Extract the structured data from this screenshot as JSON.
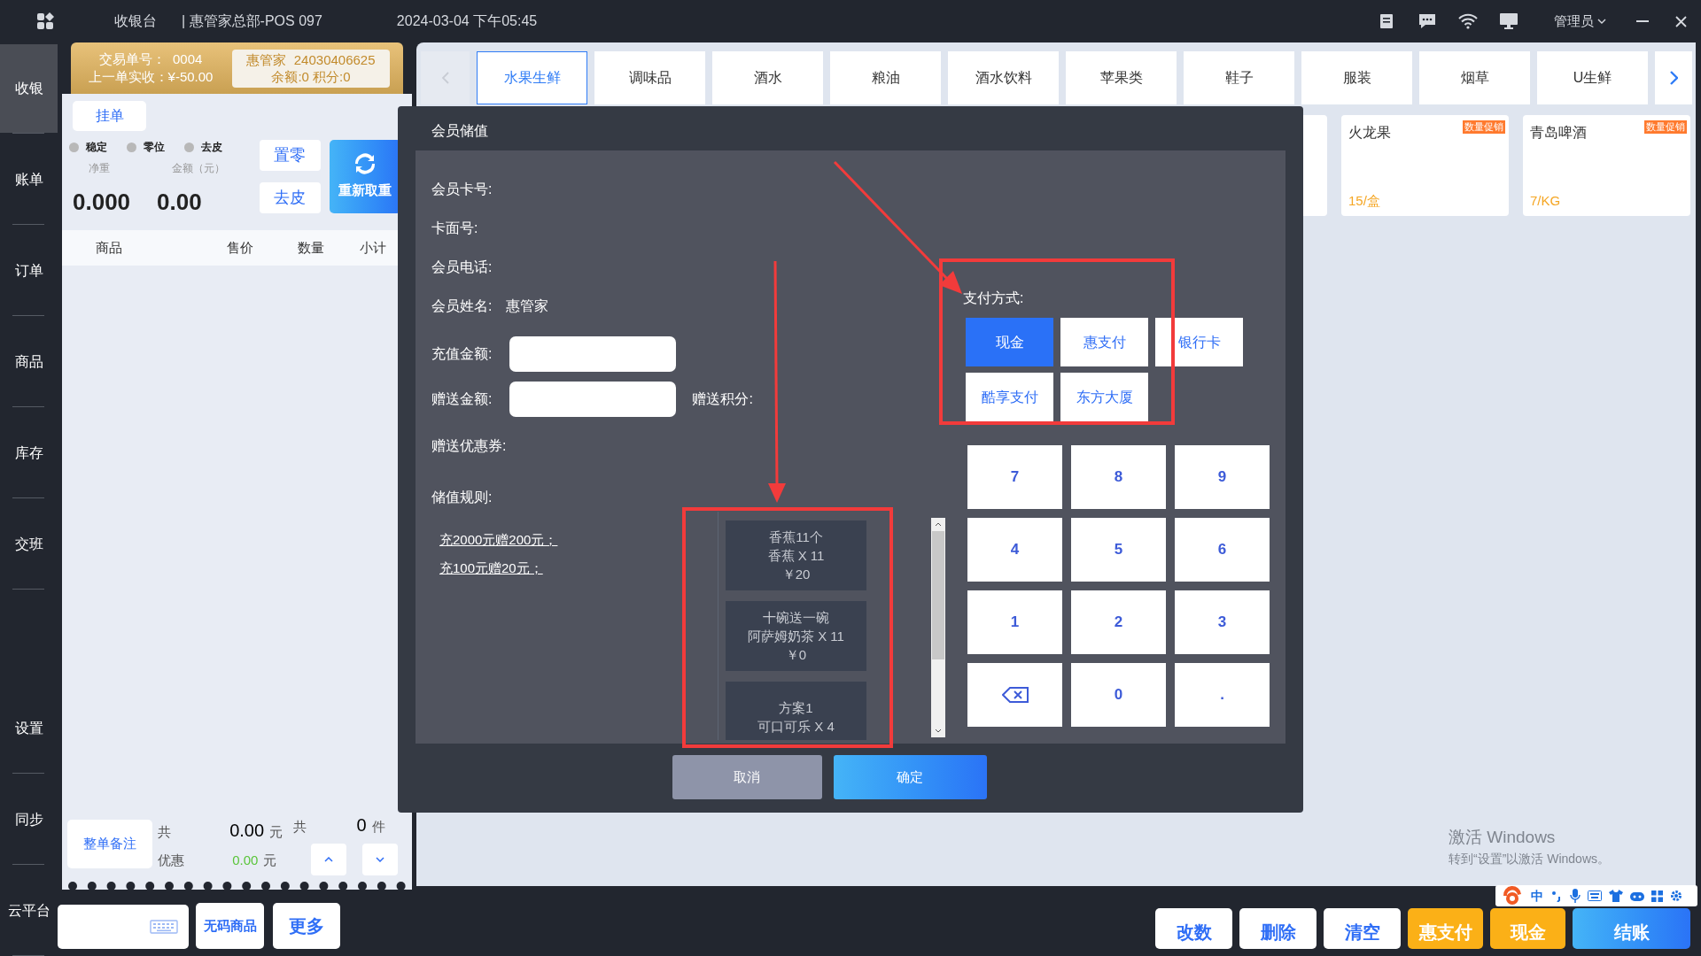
{
  "top_bar": {
    "title": "收银台",
    "store": "| 惠管家总部-POS 097",
    "datetime": "2024-03-04 下午05:45",
    "user": "管理员"
  },
  "nav": {
    "main": [
      {
        "label": "收银",
        "selected": true
      },
      {
        "label": "账单",
        "selected": false
      },
      {
        "label": "订单",
        "selected": false
      },
      {
        "label": "商品",
        "selected": false
      },
      {
        "label": "库存",
        "selected": false
      },
      {
        "label": "交班",
        "selected": false
      }
    ],
    "bottom": [
      {
        "label": "设置",
        "selected": false
      },
      {
        "label": "同步",
        "selected": false
      },
      {
        "label": "云平台",
        "selected": false
      }
    ]
  },
  "order_header": {
    "transaction_label": "交易单号：",
    "transaction_no": "0004",
    "last_label": "上一单实收：",
    "last_amount": "¥-50.00",
    "member_name": "惠管家",
    "member_no": "24030406625",
    "member_balance": "余额:0 积分:0"
  },
  "hold_button": "挂单",
  "scale": {
    "indicators": [
      {
        "label": "稳定",
        "on": false
      },
      {
        "label": "零位",
        "on": false
      },
      {
        "label": "去皮",
        "on": false
      }
    ],
    "weight_label": "净重",
    "amount_label": "金额（元）",
    "weight": "0.000",
    "amount": "0.00",
    "zero_button": "置零",
    "tare_button": "去皮",
    "reweigh_button": "重新取重"
  },
  "cart_columns": [
    "商品",
    "售价",
    "数量",
    "小计"
  ],
  "totals": {
    "note_button": "整单备注",
    "total_label": "共",
    "total": "0.00",
    "total_unit": "元",
    "count_label": "共",
    "count": "0",
    "count_unit": "件",
    "discount_label": "优惠",
    "discount": "0.00",
    "discount_unit": "元"
  },
  "categories": [
    {
      "label": "水果生鲜",
      "selected": true
    },
    {
      "label": "调味品",
      "selected": false
    },
    {
      "label": "酒水",
      "selected": false
    },
    {
      "label": "粮油",
      "selected": false
    },
    {
      "label": "酒水饮料",
      "selected": false
    },
    {
      "label": "苹果类",
      "selected": false
    },
    {
      "label": "鞋子",
      "selected": false
    },
    {
      "label": "服装",
      "selected": false
    },
    {
      "label": "烟草",
      "selected": false
    },
    {
      "label": "U生鲜",
      "selected": false
    }
  ],
  "products": [
    {
      "name": "火龙果",
      "tag": "数量促销",
      "price": "15/盒"
    },
    {
      "name": "青岛啤酒",
      "tag": "数量促销",
      "price": "7/KG"
    }
  ],
  "dialog": {
    "title": "会员储值",
    "info": [
      {
        "label": "会员卡号:"
      },
      {
        "label": "卡面号:"
      },
      {
        "label": "会员电话:"
      },
      {
        "label": "会员姓名:",
        "value": "惠管家"
      }
    ],
    "recharge_label": "充值金额:",
    "gift_amount_label": "赠送金额:",
    "gift_points_label": "赠送积分:",
    "coupon_label": "赠送优惠券:",
    "rules_label": "储值规则:",
    "rules": [
      "充2000元赠200元；",
      "充100元赠20元；"
    ],
    "promotions": [
      {
        "lines": [
          "香蕉11个",
          "香蕉 X 11",
          "￥20"
        ]
      },
      {
        "lines": [
          "十碗送一碗",
          "阿萨姆奶茶 X 11",
          "￥0"
        ]
      },
      {
        "lines": [
          "方案1",
          "可口可乐 X 4"
        ]
      }
    ],
    "payment_label": "支付方式:",
    "payment_methods": [
      {
        "label": "现金",
        "selected": true
      },
      {
        "label": "惠支付",
        "selected": false
      },
      {
        "label": "银行卡",
        "selected": false
      },
      {
        "label": "酷享支付",
        "selected": false
      },
      {
        "label": "东方大厦",
        "selected": false
      }
    ],
    "keypad": [
      {
        "kind": "digit",
        "label": "7"
      },
      {
        "kind": "digit",
        "label": "8"
      },
      {
        "kind": "digit",
        "label": "9"
      },
      {
        "kind": "digit",
        "label": "4"
      },
      {
        "kind": "digit",
        "label": "5"
      },
      {
        "kind": "digit",
        "label": "6"
      },
      {
        "kind": "digit",
        "label": "1"
      },
      {
        "kind": "digit",
        "label": "2"
      },
      {
        "kind": "digit",
        "label": "3"
      },
      {
        "kind": "backspace"
      },
      {
        "kind": "digit",
        "label": "0"
      },
      {
        "kind": "digit",
        "label": "."
      }
    ],
    "cancel_button": "取消",
    "confirm_button": "确定"
  },
  "bottom_bar": {
    "no_code_button": "无码商品",
    "more_button": "更多",
    "actions": [
      {
        "label": "改数",
        "kind": "plain"
      },
      {
        "label": "删除",
        "kind": "plain"
      },
      {
        "label": "清空",
        "kind": "plain"
      },
      {
        "label": "惠支付",
        "kind": "warm"
      },
      {
        "label": "现金",
        "kind": "warm"
      },
      {
        "label": "结账",
        "kind": "primary"
      }
    ],
    "ime_label": "中"
  },
  "watermark": [
    "激活 Windows",
    "转到“设置”以激活 Windows。"
  ]
}
